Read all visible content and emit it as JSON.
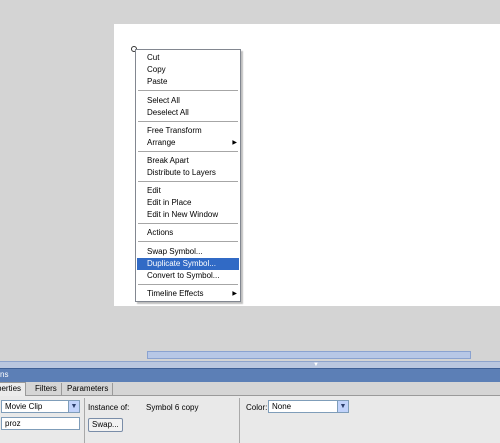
{
  "context_menu": {
    "items": [
      {
        "label": "Cut"
      },
      {
        "label": "Copy"
      },
      {
        "label": "Paste"
      },
      {
        "label": "Select All"
      },
      {
        "label": "Deselect All"
      },
      {
        "label": "Free Transform"
      },
      {
        "label": "Arrange",
        "submenu": true
      },
      {
        "label": "Break Apart"
      },
      {
        "label": "Distribute to Layers"
      },
      {
        "label": "Edit"
      },
      {
        "label": "Edit in Place"
      },
      {
        "label": "Edit in New Window"
      },
      {
        "label": "Actions"
      },
      {
        "label": "Swap Symbol..."
      },
      {
        "label": "Duplicate Symbol...",
        "highlighted": true
      },
      {
        "label": "Convert to Symbol..."
      },
      {
        "label": "Timeline Effects",
        "submenu": true
      }
    ],
    "submenu_arrow": "▶"
  },
  "panel": {
    "title_fragment": "ns",
    "tabs": [
      {
        "label": "perties",
        "active": true
      },
      {
        "label": "Filters"
      },
      {
        "label": "Parameters"
      }
    ],
    "symbol_type": "Movie Clip",
    "instance_name": "proz",
    "instance_of_label": "Instance of:",
    "instance_of_value": "Symbol 6 copy",
    "swap_button": "Swap...",
    "color_label": "Color:",
    "color_value": "None"
  },
  "icons": {
    "dropdown_arrow": "▼",
    "collapse_arrow": "▼"
  },
  "colors": {
    "highlight": "#316ac5",
    "panel_title": "#5c7fb6",
    "stage": "#ffffff",
    "workspace": "#d4d4d4"
  }
}
